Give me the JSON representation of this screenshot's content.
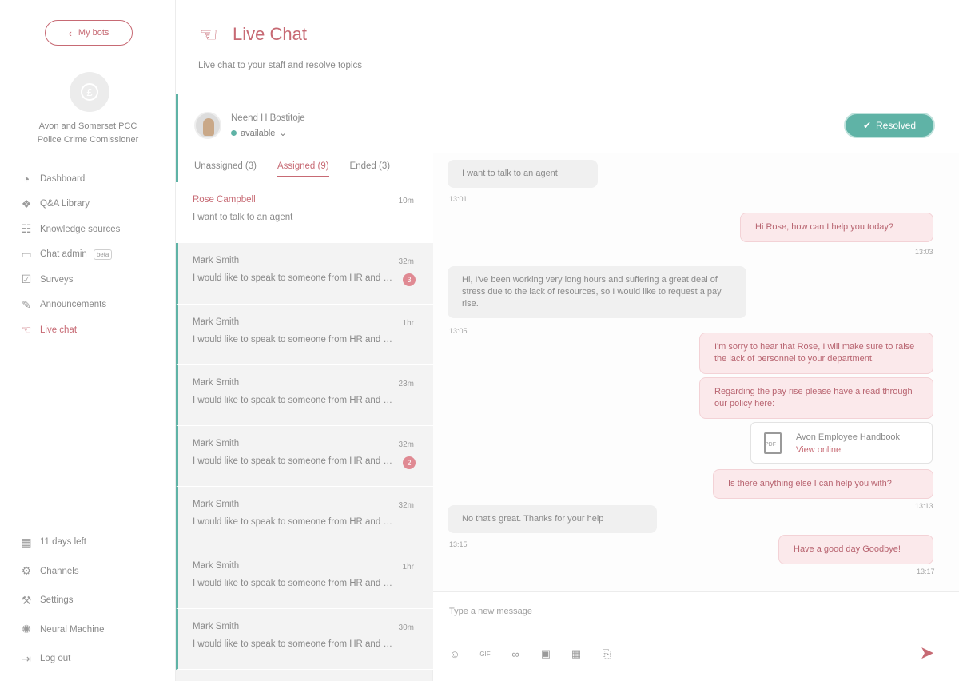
{
  "sidebar": {
    "back_label": "My bots",
    "org_line1": "Avon and Somerset PCC",
    "org_line2": "Police Crime Comissioner",
    "nav": [
      {
        "label": "Dashboard",
        "icon": "dashboard-icon",
        "glyph": "◔"
      },
      {
        "label": "Q&A Library",
        "icon": "library-icon",
        "glyph": "❖"
      },
      {
        "label": "Knowledge sources",
        "icon": "knowledge-icon",
        "glyph": "☷"
      },
      {
        "label": "Chat admin",
        "icon": "chat-admin-icon",
        "glyph": "▭",
        "badge": "beta"
      },
      {
        "label": "Surveys",
        "icon": "surveys-icon",
        "glyph": "☑"
      },
      {
        "label": "Announcements",
        "icon": "announcements-icon",
        "glyph": "✎"
      },
      {
        "label": "Live chat",
        "icon": "live-chat-icon",
        "glyph": "☜"
      }
    ],
    "bottom": [
      {
        "label": "11 days left",
        "icon": "calendar-icon",
        "glyph": "▦"
      },
      {
        "label": "Channels",
        "icon": "channels-icon",
        "glyph": "⚙"
      },
      {
        "label": "Settings",
        "icon": "settings-icon",
        "glyph": "⚒"
      },
      {
        "label": "Neural Machine",
        "icon": "neural-icon",
        "glyph": "✺"
      },
      {
        "label": "Log out",
        "icon": "logout-icon",
        "glyph": "⇥"
      }
    ]
  },
  "header": {
    "title": "Live Chat",
    "subtitle": "Live chat to your staff and resolve topics"
  },
  "agent": {
    "name": "Neend H Bostitoje",
    "status": "available",
    "status_arrow": "⌄"
  },
  "tabs": [
    {
      "label": "Unassigned (3)"
    },
    {
      "label": "Assigned (9)"
    },
    {
      "label": "Ended (3)"
    }
  ],
  "conversations": [
    {
      "name": "Rose Campbell",
      "time": "10m",
      "message": "I want to talk to an agent",
      "badge": ""
    },
    {
      "name": "Mark Smith",
      "time": "32m",
      "message": "I would like to speak to someone from HR and about",
      "badge": "3"
    },
    {
      "name": "Mark Smith",
      "time": "1hr",
      "message": "I would like to speak to someone from HR and about",
      "badge": ""
    },
    {
      "name": "Mark Smith",
      "time": "23m",
      "message": "I would like to speak to someone from HR and about",
      "badge": ""
    },
    {
      "name": "Mark Smith",
      "time": "32m",
      "message": "I would like to speak to someone from HR and about",
      "badge": "2"
    },
    {
      "name": "Mark Smith",
      "time": "32m",
      "message": "I would like to speak to someone from HR and about",
      "badge": ""
    },
    {
      "name": "Mark Smith",
      "time": "1hr",
      "message": "I would like to speak to someone from HR and about",
      "badge": ""
    },
    {
      "name": "Mark Smith",
      "time": "30m",
      "message": "I would like to speak to someone from HR and about",
      "badge": ""
    }
  ],
  "chat": {
    "resolve_label": "Resolved",
    "messages": [
      {
        "text": "I want to talk to an agent",
        "time": "13:01"
      },
      {
        "text": "Hi Rose, how can I help you today?",
        "time": "13:03"
      },
      {
        "text": "Hi, I've been working very long hours and suffering a great deal of stress due to the lack of resources, so I would like to request a pay rise.",
        "time": "13:05"
      },
      {
        "text": "I'm sorry to hear that Rose, I will make sure to raise the lack of personnel to your department.",
        "time": ""
      },
      {
        "text": "Regarding the pay rise please have a read through our policy here:",
        "time": ""
      },
      {
        "text": "Is there anything else I can help you with?",
        "time": "13:13"
      },
      {
        "text": "No that's great. Thanks for your help",
        "time": "13:15"
      },
      {
        "text": "Have a good day Goodbye!",
        "time": "13:17"
      }
    ],
    "document": {
      "name": "Avon Employee Handbook",
      "link": "View online"
    },
    "composer_placeholder": "Type a new message",
    "tools": [
      {
        "icon": "emoji-icon",
        "glyph": "☺"
      },
      {
        "icon": "gif-icon",
        "glyph": "GIF"
      },
      {
        "icon": "link-icon",
        "glyph": "∞"
      },
      {
        "icon": "image-icon",
        "glyph": "▣"
      },
      {
        "icon": "calendar-attach-icon",
        "glyph": "▦"
      },
      {
        "icon": "attachment-icon",
        "glyph": "⎘"
      }
    ]
  },
  "colors": {
    "accent": "#c76a74",
    "teal": "#5fb3a6",
    "panel": "#f3f3f3"
  }
}
